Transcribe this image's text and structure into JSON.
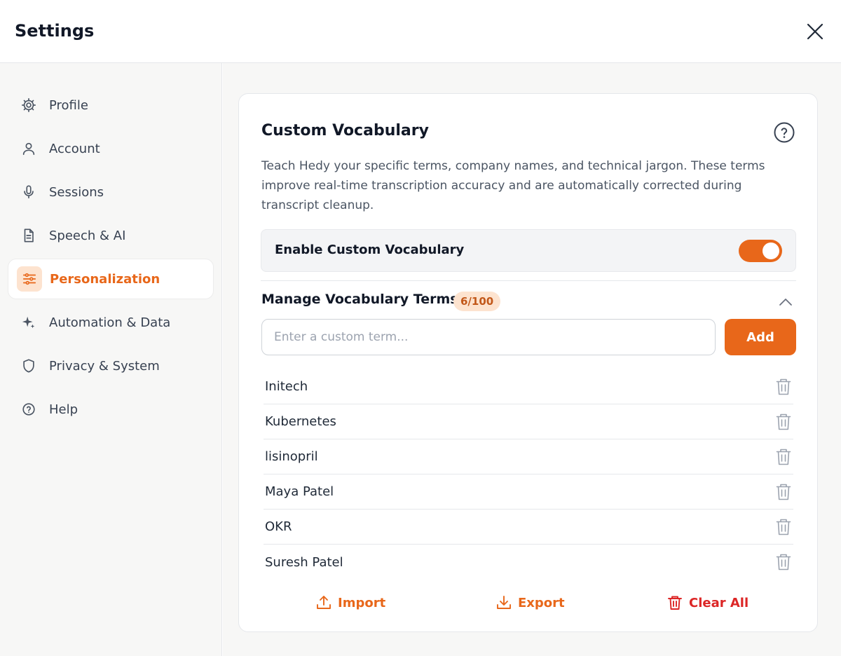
{
  "header": {
    "title": "Settings"
  },
  "sidebar": {
    "items": [
      {
        "label": "Profile",
        "icon": "gear-icon"
      },
      {
        "label": "Account",
        "icon": "user-icon"
      },
      {
        "label": "Sessions",
        "icon": "microphone-icon"
      },
      {
        "label": "Speech & AI",
        "icon": "document-icon"
      },
      {
        "label": "Personalization",
        "icon": "sliders-icon",
        "active": true
      },
      {
        "label": "Automation & Data",
        "icon": "sparkle-icon"
      },
      {
        "label": "Privacy & System",
        "icon": "shield-icon"
      },
      {
        "label": "Help",
        "icon": "question-circle-icon"
      }
    ]
  },
  "card": {
    "title": "Custom Vocabulary",
    "description": "Teach Hedy your specific terms, company names, and technical jargon. These terms improve real-time transcription accuracy and are automatically corrected during transcript cleanup.",
    "toggle_label": "Enable Custom Vocabulary",
    "toggle_on": true,
    "manage_title": "Manage Vocabulary Terms",
    "count_badge": "6/100",
    "input": {
      "placeholder": "Enter a custom term...",
      "value": ""
    },
    "add_label": "Add",
    "terms": [
      "Initech",
      "Kubernetes",
      "lisinopril",
      "Maya Patel",
      "OKR",
      "Suresh Patel"
    ],
    "actions": {
      "import": "Import",
      "export": "Export",
      "clear": "Clear All"
    }
  },
  "colors": {
    "accent": "#e8671a",
    "danger": "#dc2626",
    "badge_bg": "#fde3cf"
  }
}
